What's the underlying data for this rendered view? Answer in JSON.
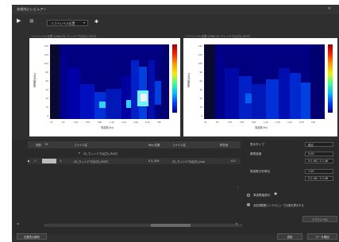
{
  "window": {
    "title": "芸術的にレビュアー",
    "close_icon": "×"
  },
  "toolbar": {
    "play_icon": "▶",
    "stop_icon": "■",
    "mode_value": "ソフトレベル位置",
    "gear_icon": "✱"
  },
  "charts": [
    {
      "header": "ソフトレベル位置  1/384  22_ウィンドウ(出力)_R0(T)",
      "ylabel": "周波数(kHz)",
      "xlabel": "周波数(Hz)",
      "yticks": [
        "140",
        "120",
        "100",
        "80",
        "60",
        "40",
        "20",
        "10",
        "0"
      ],
      "xticks": [
        "31",
        "63",
        "125",
        "250",
        "500",
        "1.0k",
        "2.0k",
        "4.0k",
        "8.0k",
        "16k"
      ]
    },
    {
      "header": "ソフトレベル位置  2/384  22_ウィンドウ(出力)_R0(T)",
      "ylabel": "周波数(kHz)",
      "xlabel": "周波数(Hz)",
      "yticks": [
        "140",
        "120",
        "100",
        "80",
        "60",
        "40",
        "20",
        "10",
        "0"
      ],
      "xticks": [
        "31",
        "63",
        "125",
        "250",
        "500",
        "1.0k",
        "2.0k",
        "4.0k",
        "8.0k",
        "16k"
      ]
    }
  ],
  "colorbar_ticks": [
    "0",
    "10",
    "20",
    "30",
    "40",
    "50",
    "60",
    "70",
    "80",
    "90"
  ],
  "table": {
    "headers": [
      "状態",
      "M",
      "ファイル名",
      "Rev/位置",
      "ファイル名",
      "所在地"
    ],
    "rows": [
      {
        "name": "22_ウィンドウ(出力)_R0(T)",
        "rev": "",
        "file": "",
        "loc": ""
      },
      {
        "name": "22_ウィンドウ(出力)_R0(T)",
        "rev": "0.5_305",
        "file": "22_ウィンドウ(出力)_trax",
        "loc": "0.0"
      }
    ]
  },
  "side": {
    "type_label": "表示タイプ",
    "type_value": "既定",
    "gain_label": "基準感度",
    "gain_value": "0.00",
    "gain_sub": "0.0 dB / 1.0 dB",
    "ref_label": "周波数分析単位",
    "ref_value": "1.00",
    "ref_sub": "0.0 dB / 1.0 dB",
    "radio1": "周波数幅表示",
    "radio2": "区間範囲",
    "radio3": "全区間範囲にレベルビューで比較を表示する",
    "apply_button": "ソフトレベル"
  },
  "footer": {
    "left_button": "位置表示解析",
    "ok_button": "適用",
    "cancel_button": "データ確認"
  }
}
